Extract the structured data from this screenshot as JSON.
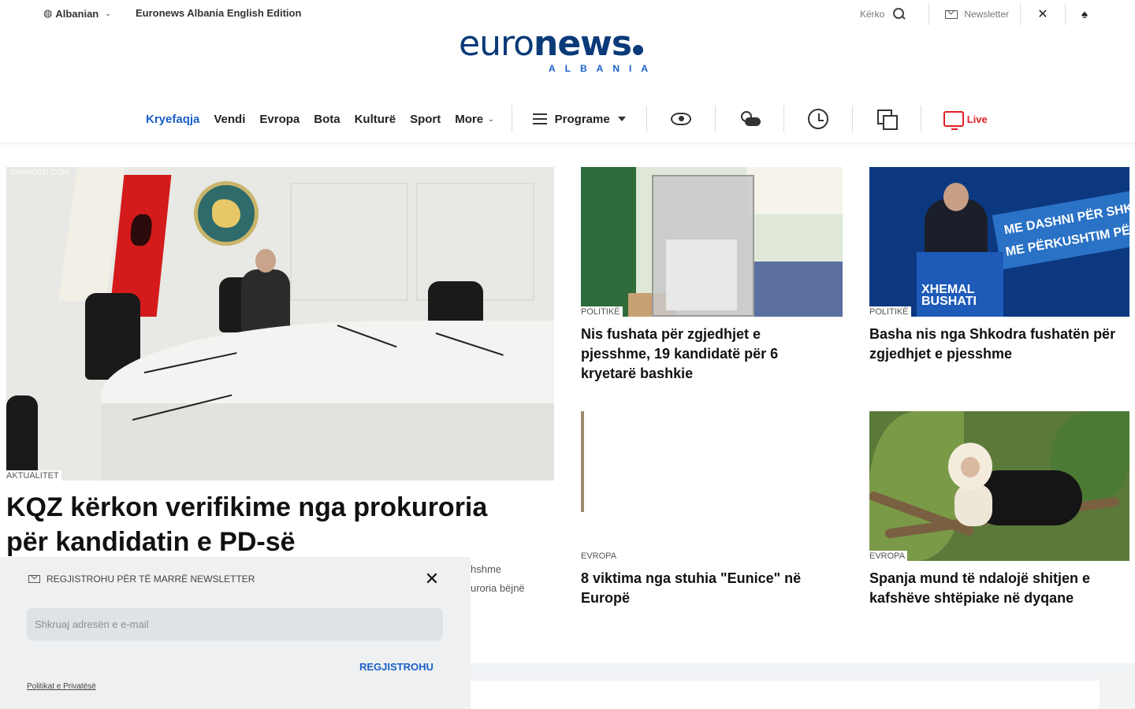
{
  "topbar": {
    "language": "Albanian",
    "edition": "Euronews Albania English Edition",
    "search_label": "Kërko",
    "newsletter_label": "Newsletter",
    "x_icon": "x-logo-icon",
    "more_icon": "more-icon"
  },
  "logo": {
    "main_light": "euro",
    "main_bold": "news",
    "sub": "ALBANIA"
  },
  "nav": {
    "items": [
      "Kryefaqja",
      "Vendi",
      "Evropa",
      "Bota",
      "Kulturë",
      "Sport"
    ],
    "more_label": "More",
    "programs_label": "Programe",
    "live_label": "Live",
    "active_color": "#1a5fc8",
    "live_color": "#e21f26"
  },
  "lead": {
    "photo_credit": "SAPHOTO.COM",
    "category": "AKTUALITET",
    "headline_line1": "KQZ kërkon verifikime nga prokuroria",
    "headline_line2": "për kandidatin e PD-së",
    "snippet_line1": "hshme",
    "snippet_line2": "uroria bëjnë"
  },
  "articles": [
    {
      "category": "POLITIKË",
      "title": "Nis fushata për zgjedhjet e pjesshme, 19 kandidatë për 6 kryetarë bashkie"
    },
    {
      "category": "POLITIKË",
      "title": "Basha nis nga Shkodra fushatën për zgjedhjet e pjesshme"
    },
    {
      "category": "EVROPA",
      "title": "8 viktima nga stuhia \"Eunice\" në Europë"
    },
    {
      "category": "EVROPA",
      "title": "Spanja mund të ndalojë shitjen e kafshëve shtëpiake në dyqane"
    }
  ],
  "banner_text": {
    "line1": "ME DASHNI PËR SHK",
    "line2": "ME PËRKUSHTIM PË",
    "podium": "XHEMAL BUSHATI"
  },
  "popup": {
    "title": "REGJISTROHU PËR TË MARRË NEWSLETTER",
    "placeholder": "Shkruaj adresën e e-mail",
    "submit": "REGJISTROHU",
    "privacy": "Politikat e Privatësë"
  }
}
